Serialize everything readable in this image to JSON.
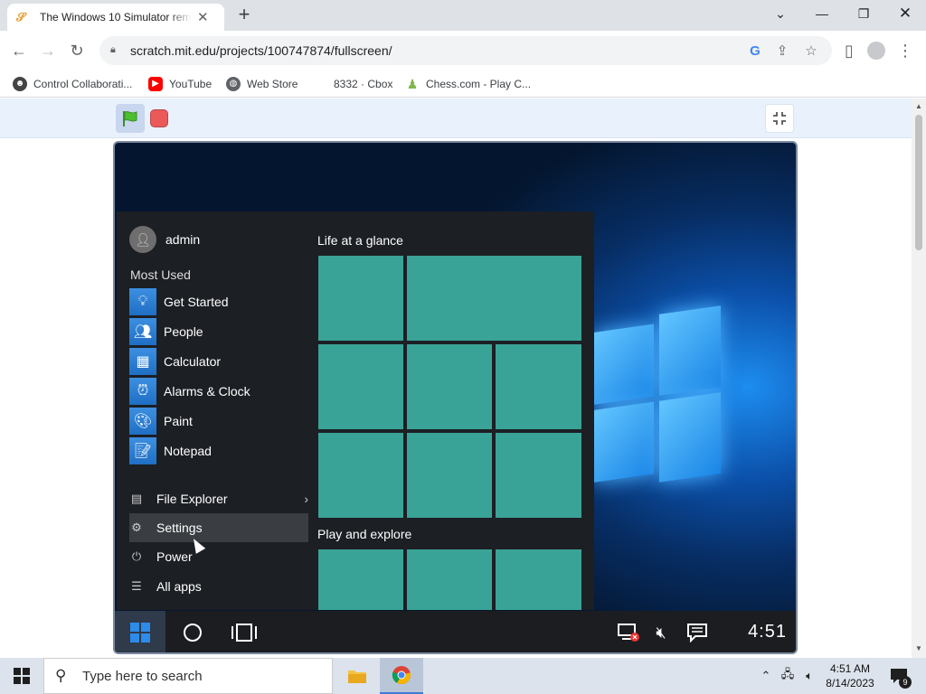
{
  "browser": {
    "tab": {
      "title": "The Windows 10 Simulator remi",
      "favicon": "scratch-icon"
    },
    "new_tab": "+",
    "url": "scratch.mit.edu/projects/100747874/fullscreen/",
    "bookmarks": [
      {
        "label": "Control Collaborati...",
        "icon": "scratch-cat-icon"
      },
      {
        "label": "YouTube",
        "icon": "youtube-icon"
      },
      {
        "label": "Web Store",
        "icon": "web-store-icon"
      },
      {
        "label": "8332 · Cbox",
        "icon": "cbox-icon"
      },
      {
        "label": "Chess.com - Play C...",
        "icon": "chess-icon"
      }
    ]
  },
  "simulator": {
    "user": "admin",
    "most_used_header": "Most Used",
    "apps": [
      {
        "label": "Get Started",
        "icon": "lightbulb-icon"
      },
      {
        "label": "People",
        "icon": "people-icon"
      },
      {
        "label": "Calculator",
        "icon": "calculator-icon"
      },
      {
        "label": "Alarms & Clock",
        "icon": "alarm-clock-icon"
      },
      {
        "label": "Paint",
        "icon": "paint-icon"
      },
      {
        "label": "Notepad",
        "icon": "notepad-icon"
      }
    ],
    "system": [
      {
        "label": "File Explorer",
        "icon": "file-explorer-icon",
        "arrow": "›"
      },
      {
        "label": "Settings",
        "icon": "settings-gear-icon"
      },
      {
        "label": "Power",
        "icon": "power-icon"
      },
      {
        "label": "All apps",
        "icon": "all-apps-icon"
      }
    ],
    "tiles_header_1": "Life at a glance",
    "tiles_header_2": "Play and explore",
    "tile_color": "#3aa397",
    "clock": "4:51"
  },
  "taskbar": {
    "search_placeholder": "Type here to search",
    "time": "4:51 AM",
    "date": "8/14/2023",
    "notification_count": "9"
  }
}
